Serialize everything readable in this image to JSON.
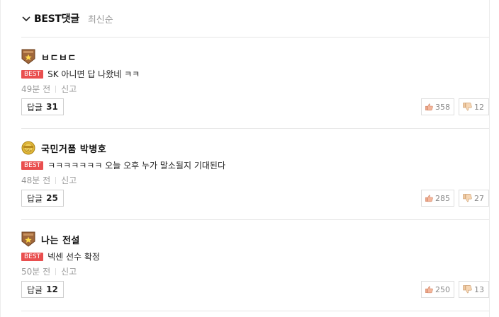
{
  "header": {
    "title": "BEST댓글",
    "sort": "최신순"
  },
  "comments": [
    {
      "nickname": "ㅂㄷㅂㄷ",
      "badge": "bronze-star-badge",
      "best": "BEST",
      "text": "SK 아니면 답 나왔네 ㅋㅋ",
      "time": "49분 전",
      "report": "신고",
      "reply_label": "답글",
      "reply_count": "31",
      "likes": "358",
      "dislikes": "12"
    },
    {
      "nickname": "국민거품 박병호",
      "badge": "gold-round-badge",
      "best": "BEST",
      "text": "ㅋㅋㅋㅋㅋㅋㅋ 오늘 오후 누가 말소될지 기대된다",
      "time": "48분 전",
      "report": "신고",
      "reply_label": "답글",
      "reply_count": "25",
      "likes": "285",
      "dislikes": "27"
    },
    {
      "nickname": "나는 전설",
      "badge": "bronze-star-badge",
      "best": "BEST",
      "text": "넥센 선수 확정",
      "time": "50분 전",
      "report": "신고",
      "reply_label": "답글",
      "reply_count": "12",
      "likes": "250",
      "dislikes": "13"
    }
  ],
  "colors": {
    "best_tag": "#e94f4f",
    "meta_gray": "#9a9a9a",
    "badge_bronze": "#a0673a",
    "badge_gold": "#e2b83a"
  }
}
